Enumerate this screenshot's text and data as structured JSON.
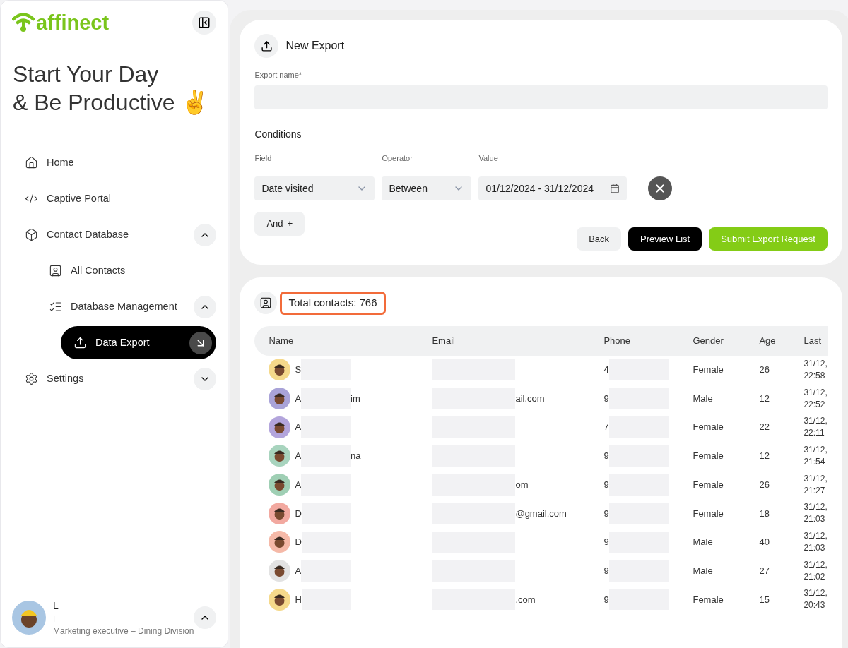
{
  "brand": {
    "name": "affinect"
  },
  "greeting": {
    "line1": "Start Your Day",
    "line2": "& Be Productive",
    "emoji": "✌️"
  },
  "nav": [
    {
      "label": "Home",
      "selected": false
    },
    {
      "label": "Captive Portal",
      "selected": false
    },
    {
      "label": "Contact Database",
      "selected": false,
      "expanded": true,
      "children": [
        {
          "label": "All Contacts",
          "selected": false
        },
        {
          "label": "Database Management",
          "selected": false,
          "expanded": true,
          "children": [
            {
              "label": "Data Export",
              "selected": true
            }
          ]
        }
      ]
    },
    {
      "label": "Settings",
      "selected": false,
      "expanded": false
    }
  ],
  "profile": {
    "name": "L",
    "line2": "I",
    "role": "Marketing executive – Dining Division",
    "expanded": true
  },
  "export_form": {
    "title": "New Export",
    "name_label": "Export name*",
    "conditions_title": "Conditions",
    "headers": {
      "field": "Field",
      "operator": "Operator",
      "value": "Value"
    },
    "condition": {
      "field": "Date visited",
      "operator": "Between",
      "value": "01/12/2024 - 31/12/2024"
    },
    "and_button": "And",
    "add_icon": "+",
    "buttons": [
      {
        "label": "Back",
        "kind": "secondary"
      },
      {
        "label": "Preview List",
        "kind": "dark"
      },
      {
        "label": "Submit Export Request",
        "kind": "primary"
      }
    ]
  },
  "contacts": {
    "total": "Total contacts: 766",
    "columns": [
      "Name",
      "Email",
      "Phone",
      "Gender",
      "Age",
      "Last"
    ],
    "rows": [
      {
        "color": "#f5d98b",
        "name": "S",
        "name_tail": "",
        "email": "",
        "phone": "4",
        "gender": "Female",
        "age": "26",
        "date": "31/12,",
        "time": "22:58"
      },
      {
        "color": "#a9a3d8",
        "name": "A",
        "name_tail": "im",
        "email": "ail.com",
        "phone": "9",
        "gender": "Male",
        "age": "12",
        "date": "31/12,",
        "time": "22:52"
      },
      {
        "color": "#b3a5dc",
        "name": "A",
        "name_tail": "",
        "email": "",
        "phone": "7",
        "gender": "Female",
        "age": "22",
        "date": "31/12,",
        "time": "22:11"
      },
      {
        "color": "#a8d4be",
        "name": "A",
        "name_tail": "na",
        "email": "",
        "phone": "9",
        "gender": "Female",
        "age": "12",
        "date": "31/12,",
        "time": "21:54"
      },
      {
        "color": "#9fcfb4",
        "name": "A",
        "name_tail": "",
        "email": "om",
        "phone": "9",
        "gender": "Female",
        "age": "26",
        "date": "31/12,",
        "time": "21:27"
      },
      {
        "color": "#f2a9a0",
        "name": "D",
        "name_tail": "",
        "email": "@gmail.com",
        "phone": "9",
        "gender": "Female",
        "age": "18",
        "date": "31/12,",
        "time": "21:03"
      },
      {
        "color": "#f5b9a8",
        "name": "D",
        "name_tail": "",
        "email": "",
        "phone": "9",
        "gender": "Male",
        "age": "40",
        "date": "31/12,",
        "time": "21:03"
      },
      {
        "color": "#e2e2e2",
        "name": "A",
        "name_tail": "",
        "email": "",
        "phone": "9",
        "gender": "Male",
        "age": "27",
        "date": "31/12,",
        "time": "21:02"
      },
      {
        "color": "#f5d98b",
        "name": "H",
        "name_tail": "",
        "email": ".com",
        "phone": "9",
        "gender": "Female",
        "age": "15",
        "date": "31/12,",
        "time": "20:43"
      }
    ]
  }
}
